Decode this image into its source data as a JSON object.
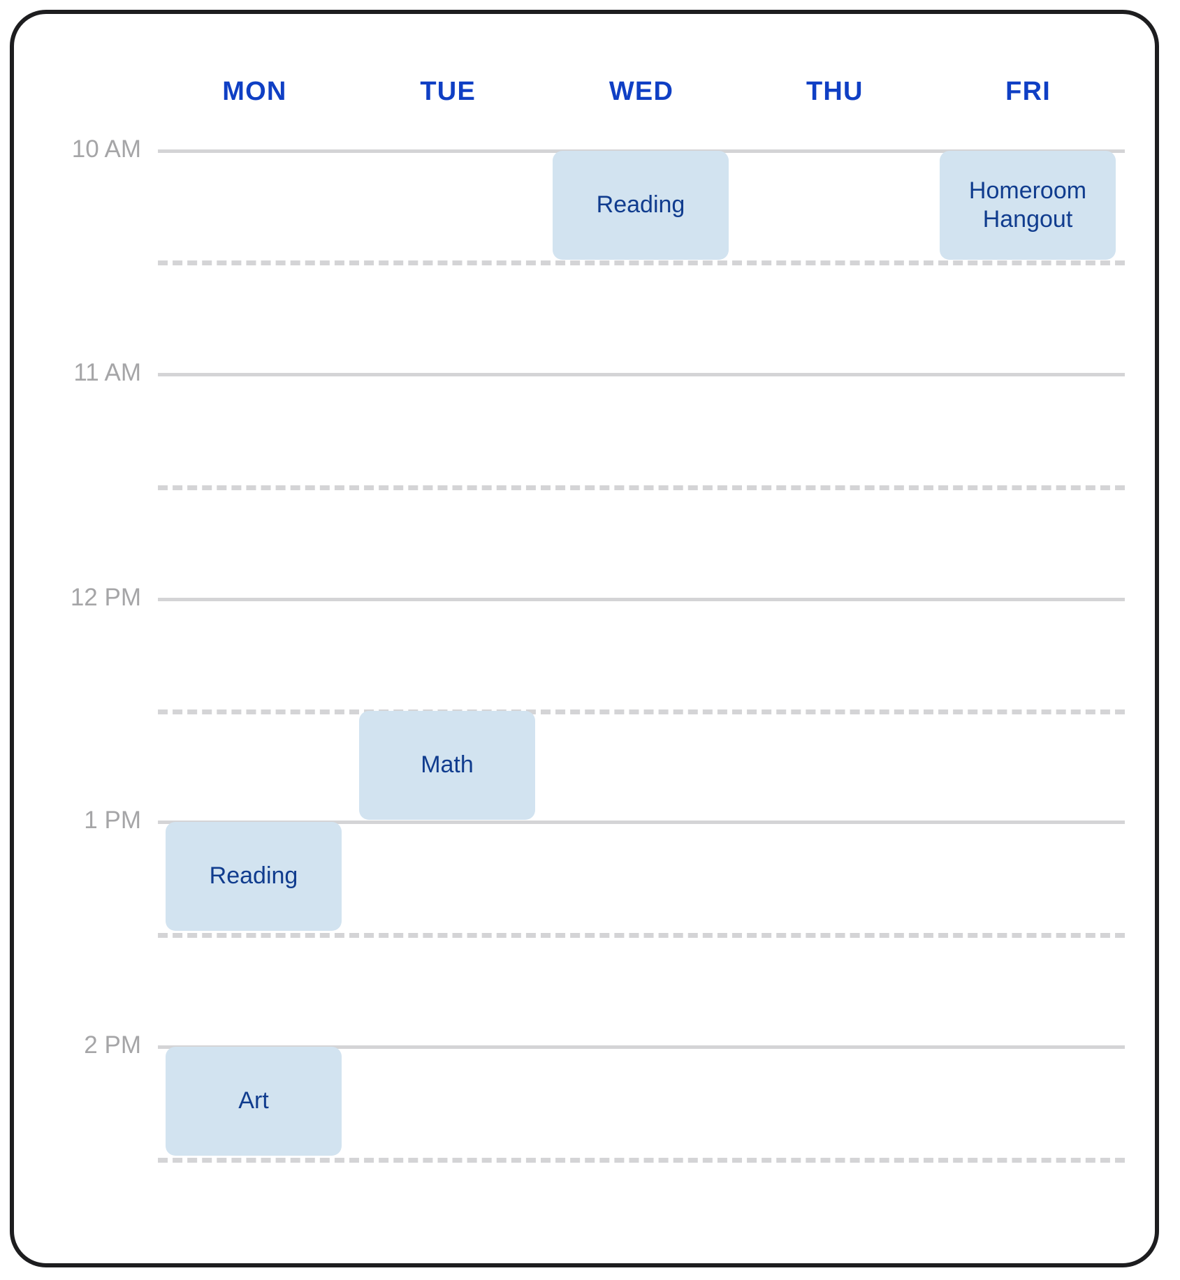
{
  "card": {
    "accent_color": "#0f3fc4",
    "event_bg_color": "#d2e3f0",
    "event_text_color": "#103c8e",
    "gridline_color": "#d4d4d6",
    "time_label_color": "#a5a5a7",
    "border_color": "#1d1d1f"
  },
  "header": {
    "days": [
      {
        "label": "MON"
      },
      {
        "label": "TUE"
      },
      {
        "label": "WED"
      },
      {
        "label": "THU"
      },
      {
        "label": "FRI"
      }
    ]
  },
  "time_axis": {
    "hours": [
      {
        "label": "10 AM"
      },
      {
        "label": "11 AM"
      },
      {
        "label": "12 PM"
      },
      {
        "label": "1 PM"
      },
      {
        "label": "2 PM"
      }
    ],
    "half_hour_labels": [
      "",
      "",
      "",
      "",
      ""
    ]
  },
  "events": [
    {
      "title": "Reading",
      "day": "WED",
      "day_index": 2,
      "start": "10:00 AM",
      "end": "10:30 AM"
    },
    {
      "title": "Homeroom\nHangout",
      "day": "FRI",
      "day_index": 4,
      "start": "10:00 AM",
      "end": "10:30 AM"
    },
    {
      "title": "Math",
      "day": "TUE",
      "day_index": 1,
      "start": "12:30 PM",
      "end": "1:00 PM"
    },
    {
      "title": "Reading",
      "day": "MON",
      "day_index": 0,
      "start": "1:00 PM",
      "end": "1:30 PM"
    },
    {
      "title": "Art",
      "day": "MON",
      "day_index": 0,
      "start": "2:00 PM",
      "end": "2:30 PM"
    }
  ]
}
